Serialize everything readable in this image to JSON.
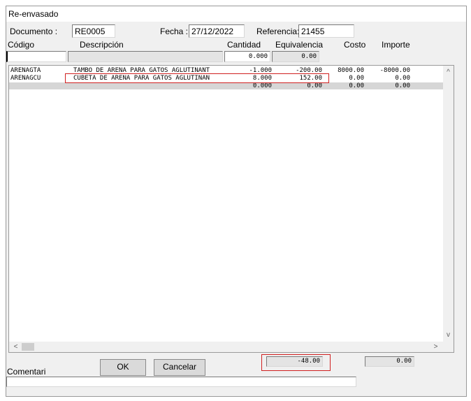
{
  "window": {
    "title": "Re-envasado"
  },
  "header": {
    "documento_label": "Documento :",
    "documento_value": "RE0005",
    "fecha_label": "Fecha :",
    "fecha_value": "27/12/2022",
    "referencia_label": "Referencia:",
    "referencia_value": "21455"
  },
  "columns": {
    "codigo": "Código",
    "descripcion": "Descripción",
    "cantidad": "Cantidad",
    "equivalencia": "Equivalencia",
    "costo": "Costo",
    "importe": "Importe"
  },
  "entry": {
    "codigo": "",
    "descripcion": "",
    "cantidad": "0.000",
    "equivalencia": "0.00"
  },
  "rows": [
    {
      "codigo": "ARENAGTA",
      "descripcion": "TAMBO DE ARENA PARA GATOS AGLUTINANT",
      "cantidad": "-1.000",
      "equivalencia": "-200.00",
      "costo": "8000.00",
      "importe": "-8000.00"
    },
    {
      "codigo": "ARENAGCU",
      "descripcion": "CUBETA DE ARENA PARA GATOS AGLUTINAN",
      "cantidad": "8.000",
      "equivalencia": "152.00",
      "costo": "0.00",
      "importe": "0.00"
    },
    {
      "codigo": "",
      "descripcion": "",
      "cantidad": "0.000",
      "equivalencia": "0.00",
      "costo": "0.00",
      "importe": "0.00"
    }
  ],
  "scroll": {
    "up": "^",
    "down": "v",
    "left": "<",
    "right": ">"
  },
  "footer": {
    "ok_label": "OK",
    "cancel_label": "Cancelar",
    "total_equivalencia": "-48.00",
    "total_importe": "0.00",
    "comentario_label": "Comentari",
    "comentario_value": ""
  }
}
